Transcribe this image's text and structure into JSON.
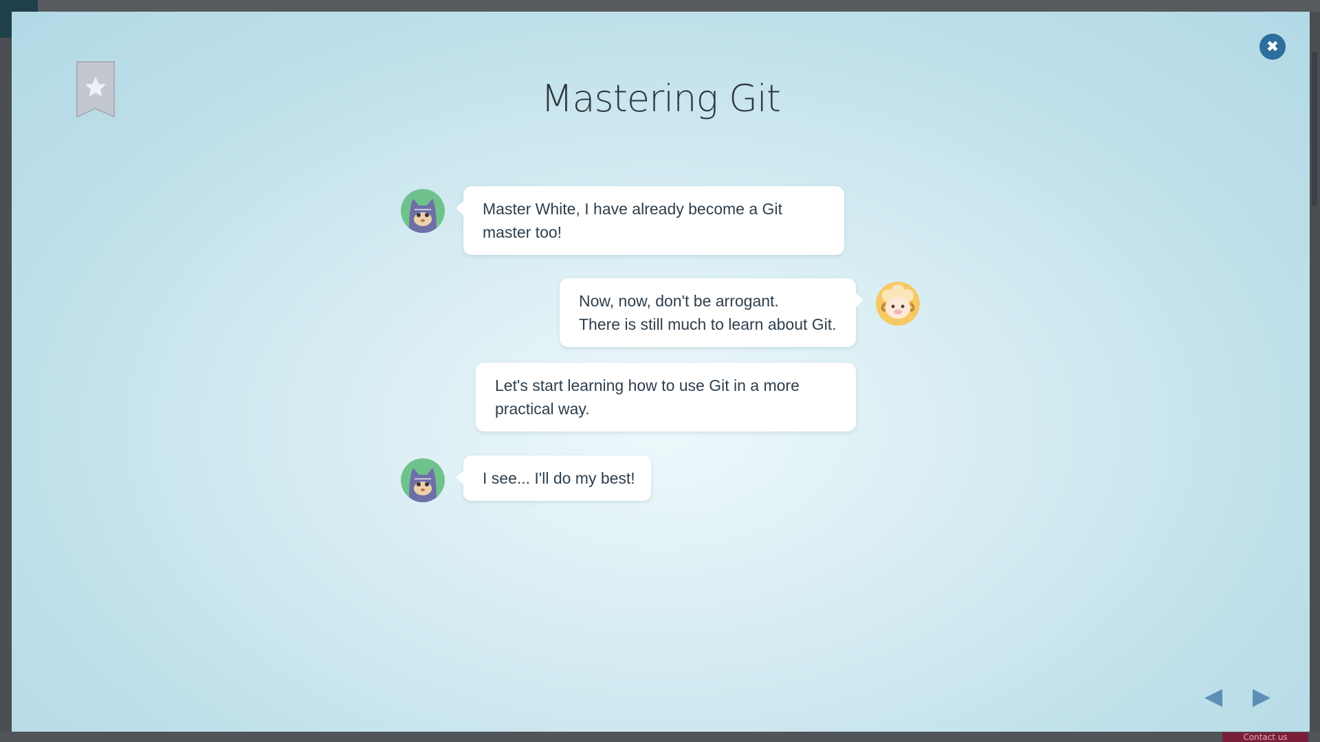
{
  "background": {
    "contact_label": "Contact us"
  },
  "modal": {
    "title": "Mastering Git",
    "close_icon": "close-icon",
    "bookmark_icon": "bookmark-star-icon",
    "accent_color": "#2e6e9e",
    "messages": [
      {
        "speaker": "cat-student",
        "side": "left",
        "lines": [
          "Master White, I have already become a Git",
          "master too!"
        ]
      },
      {
        "speaker": "sheep-master",
        "side": "right",
        "lines": [
          "Now, now, don't be arrogant.",
          "There is still much to learn about Git."
        ]
      },
      {
        "speaker": "sheep-master",
        "side": "right",
        "lines": [
          "Let's start learning how to use Git in a more",
          "practical way."
        ]
      },
      {
        "speaker": "cat-student",
        "side": "left",
        "lines": [
          "I see... I'll do my best!"
        ]
      }
    ],
    "nav": {
      "prev_icon": "prev-arrow-icon",
      "next_icon": "next-arrow-icon"
    }
  }
}
